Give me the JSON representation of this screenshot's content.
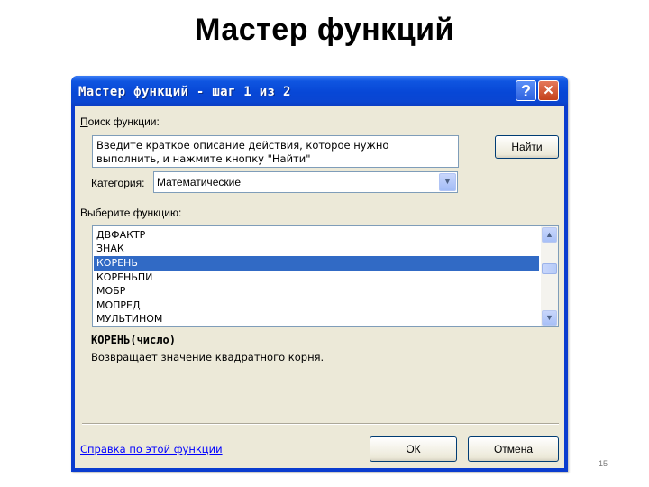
{
  "slide": {
    "title": "Мастер функций",
    "page_number": "15"
  },
  "dialog": {
    "title": "Мастер функций - шаг 1 из 2",
    "help_icon": "question-mark-icon",
    "close_icon": "close-x-icon",
    "search": {
      "label": "Поиск функции:",
      "value": "Введите краткое описание действия, которое нужно выполнить, и нажмите кнопку \"Найти\"",
      "button": "Найти"
    },
    "category": {
      "label": "Категория:",
      "value": "Математические"
    },
    "function_list": {
      "label": "Выберите функцию:",
      "items": [
        "ДВФАКТР",
        "ЗНАК",
        "КОРЕНЬ",
        "КОРЕНЬПИ",
        "МОБР",
        "МОПРЕД",
        "МУЛЬТИНОМ"
      ],
      "selected": "КОРЕНЬ"
    },
    "function_signature": "КОРЕНЬ(число)",
    "function_description": "Возвращает значение квадратного корня.",
    "help_link": "Справка по этой функции",
    "ok_button": "ОК",
    "cancel_button": "Отмена"
  },
  "colors": {
    "titlebar": "#0747d6",
    "dialog_face": "#ece9d8",
    "selection": "#316ac5",
    "link": "#0000ff"
  }
}
